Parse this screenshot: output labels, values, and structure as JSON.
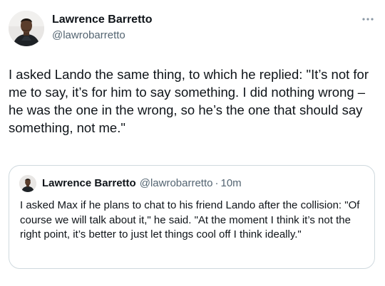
{
  "tweet": {
    "author": {
      "name": "Lawrence Barretto",
      "handle": "@lawrobarretto"
    },
    "text": "I asked Lando the same thing, to which he replied: \"It’s not for me to say, it’s for him to say something. I did nothing wrong – he was the one in the wrong, so he’s the one that should say something, not me.\"",
    "more_icon": "more-horizontal-icon"
  },
  "quoted_tweet": {
    "author": {
      "name": "Lawrence Barretto",
      "handle": "@lawrobarretto"
    },
    "separator": "·",
    "time": "10m",
    "text": "I asked Max if he plans to chat to his friend Lando after the collision: \"Of course we will talk about it,\" he said. \"At the moment I think it’s not the right point, it’s better to just let things cool off I think ideally.\""
  },
  "colors": {
    "text_primary": "#0f1419",
    "text_secondary": "#536471",
    "border": "#cfd9de",
    "background": "#ffffff"
  }
}
